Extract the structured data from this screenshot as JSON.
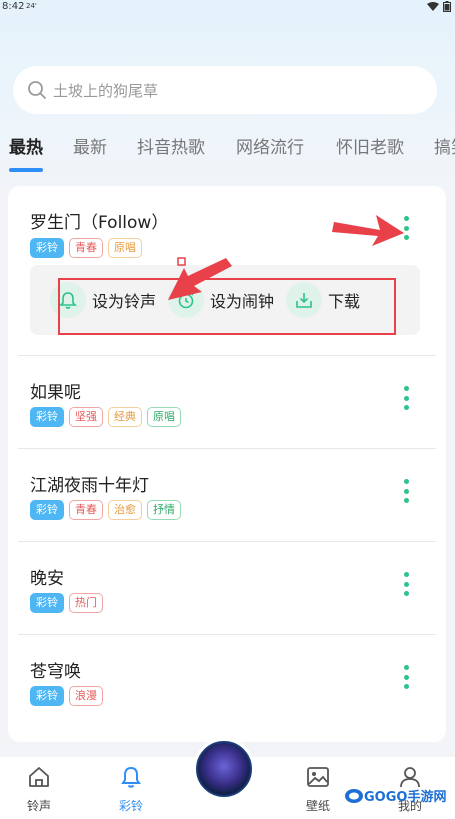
{
  "status": {
    "time": "8:42",
    "extra": "24'"
  },
  "search": {
    "placeholder": "土坡上的狗尾草"
  },
  "tabs": [
    "最热",
    "最新",
    "抖音热歌",
    "网络流行",
    "怀旧老歌",
    "搞笑"
  ],
  "songs": [
    {
      "title": "罗生门（Follow）",
      "tags": [
        "彩铃",
        "青春",
        "原唱"
      ]
    },
    {
      "title": "如果呢",
      "tags": [
        "彩铃",
        "坚强",
        "经典",
        "原唱"
      ]
    },
    {
      "title": "江湖夜雨十年灯",
      "tags": [
        "彩铃",
        "青春",
        "治愈",
        "抒情"
      ]
    },
    {
      "title": "晚安",
      "tags": [
        "彩铃",
        "热门"
      ]
    },
    {
      "title": "苍穹唤",
      "tags": [
        "彩铃",
        "浪漫"
      ]
    }
  ],
  "actions": {
    "ringtone": "设为铃声",
    "alarm": "设为闹钟",
    "download": "下载"
  },
  "nav": {
    "ringtone": "铃声",
    "caiing": "彩铃",
    "wallpaper": "壁纸",
    "mine": "我的"
  },
  "watermark": {
    "text": "GOGO手游网"
  },
  "colors": {
    "accent": "#2f8ef6",
    "green": "#2cc489",
    "red_annotation": "#e8414a"
  }
}
